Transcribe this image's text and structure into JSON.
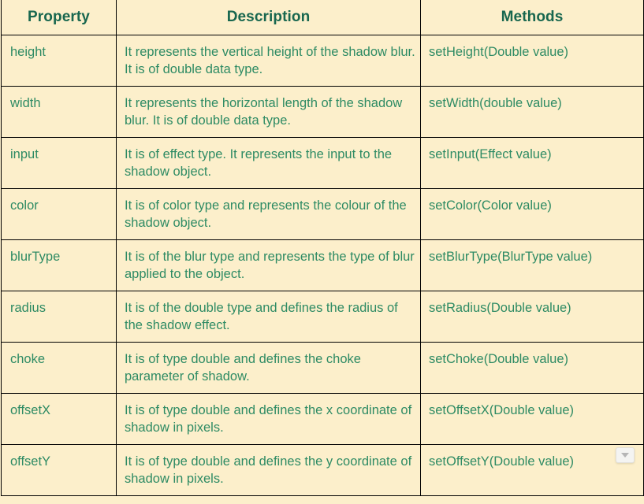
{
  "table": {
    "headers": [
      "Property",
      "Description",
      "Methods"
    ],
    "rows": [
      {
        "property": "height",
        "description": "It represents the vertical height of the shadow blur. It is of double data type.",
        "method": "setHeight(Double value)"
      },
      {
        "property": "width",
        "description": "It represents the horizontal length of the shadow blur. It is of double data type.",
        "method": "setWidth(double value)"
      },
      {
        "property": "input",
        "description": "It is of effect type. It represents the input to the shadow object.",
        "method": "setInput(Effect value)"
      },
      {
        "property": "color",
        "description": "It is of color type and represents the colour of the shadow object.",
        "method": "setColor(Color value)"
      },
      {
        "property": "blurType",
        "description": "It is of the blur type and represents the type of blur applied to the object.",
        "method": "setBlurType(BlurType value)"
      },
      {
        "property": "radius",
        "description": "It is of the double type and defines the radius of the shadow effect.",
        "method": "setRadius(Double value)"
      },
      {
        "property": "choke",
        "description": "It is of type double and defines the choke parameter of shadow.",
        "method": "setChoke(Double value)"
      },
      {
        "property": "offsetX",
        "description": "It is of type double and defines the x coordinate of shadow in pixels.",
        "method": "setOffsetX(Double value)"
      },
      {
        "property": "offsetY",
        "description": "It is of type double and defines the y coordinate of shadow in pixels.",
        "method": "setOffsetY(Double value)"
      }
    ]
  },
  "overlay": {
    "dropdown_icon": "chevron-down-icon"
  },
  "colors": {
    "background": "#FCEFCB",
    "header_text": "#18674F",
    "body_text": "#2E8B64",
    "border": "#000000"
  }
}
